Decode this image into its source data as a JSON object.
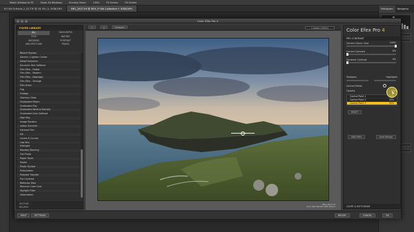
{
  "ps": {
    "menu": [
      "Match Window to PS",
      "Zoom All Windows",
      "Scrubby Zoom",
      "100%",
      "Fit Screen",
      "Fill Screen"
    ],
    "tabs": [
      "EO-Kit Ortholic-2_01.TIF @ 33.3% (1, RGB/16*)",
      "IMG_2027.tif @ 50% (* Nik Collection *, RGB/16*)"
    ],
    "right_tabs": [
      "Histogram",
      "Navigator"
    ]
  },
  "window": {
    "title": "Color Efex Pro 4"
  },
  "left_panel": {
    "header": "FILTER LIBRARY",
    "categories": [
      "ALL",
      "FAVOURITES",
      "FILM",
      "NATURE",
      "WEDDING",
      "PORTRAIT",
      "ARCHITECTURE",
      "TRAVEL"
    ],
    "filters": [
      "Bleach Bypass",
      "Darken / Lighten Center",
      "Detail Extractor",
      "Dynamic Skin Softener",
      "Film Efex - Faded",
      "Film Efex - Modern",
      "Film Efex - Nostalgic",
      "Film Efex - Vintage",
      "Film Grain",
      "Fog",
      "Foliage",
      "Glamour Glow",
      "Graduated Filters",
      "Graduated Fog",
      "Graduated Neutral Density",
      "Graduated User Defined",
      "High Key",
      "Image Borders",
      "Indian Summer",
      "Infrared Film",
      "Ink",
      "Levels & Curves",
      "Low Key",
      "Midnight",
      "Monday Morning",
      "Old Photo",
      "Paper Toner",
      "Pastel",
      "Photo Stylizer",
      "Polarization",
      "Polaroid Transfer",
      "Pro Contrast",
      "Reflector Efex",
      "Remove Color Cast",
      "Skylight Filter",
      "Solarization",
      "Sunlight",
      "Tonal Contrast",
      "Vignette Filter",
      "Vignette: Blur",
      "Vignette: Lens",
      "White Neutralizer"
    ],
    "foot": [
      "HISTORY",
      "RECIPES"
    ]
  },
  "toolbar": {
    "compare": "Compare",
    "view_label": "1 Zoom (100%)"
  },
  "preview": {
    "caption_1": "IMG_2027.tif",
    "caption_2": "1/13 SEC f/8 ISO 100 24mm"
  },
  "right_panel": {
    "brand": "Color Efex Pro",
    "brand_version": "4",
    "section": "PRO CONTRAST",
    "fields": [
      {
        "label": "Correct Colour Cast",
        "value": "100%"
      },
      {
        "label": "Correct Contrast",
        "value": "0%"
      },
      {
        "label": "Dynamic Contrast",
        "value": "0%"
      }
    ],
    "shadows": "Shadows",
    "highlights": "Highlights",
    "control_points": "Control Points",
    "opacity_label": "Opacity",
    "opacity_value": "100%",
    "cp_items": [
      {
        "name": "Control Point 1",
        "value": "50%"
      },
      {
        "name": "Control Point 2",
        "value": "40%"
      },
      {
        "name": "Control Point 3",
        "value": "50%"
      }
    ],
    "reset": "RESET",
    "add_filter": "Add Filter",
    "save_recipe": "Save Recipe",
    "loupe": "LOUPE & HISTOGRAM"
  },
  "bottom": {
    "help": "HELP",
    "settings": "SETTINGS",
    "brush": "BRUSH",
    "cancel": "CANCEL",
    "ok": "OK"
  },
  "colors": {
    "accent": "#f0c020",
    "bg": "#3b3b3b"
  }
}
